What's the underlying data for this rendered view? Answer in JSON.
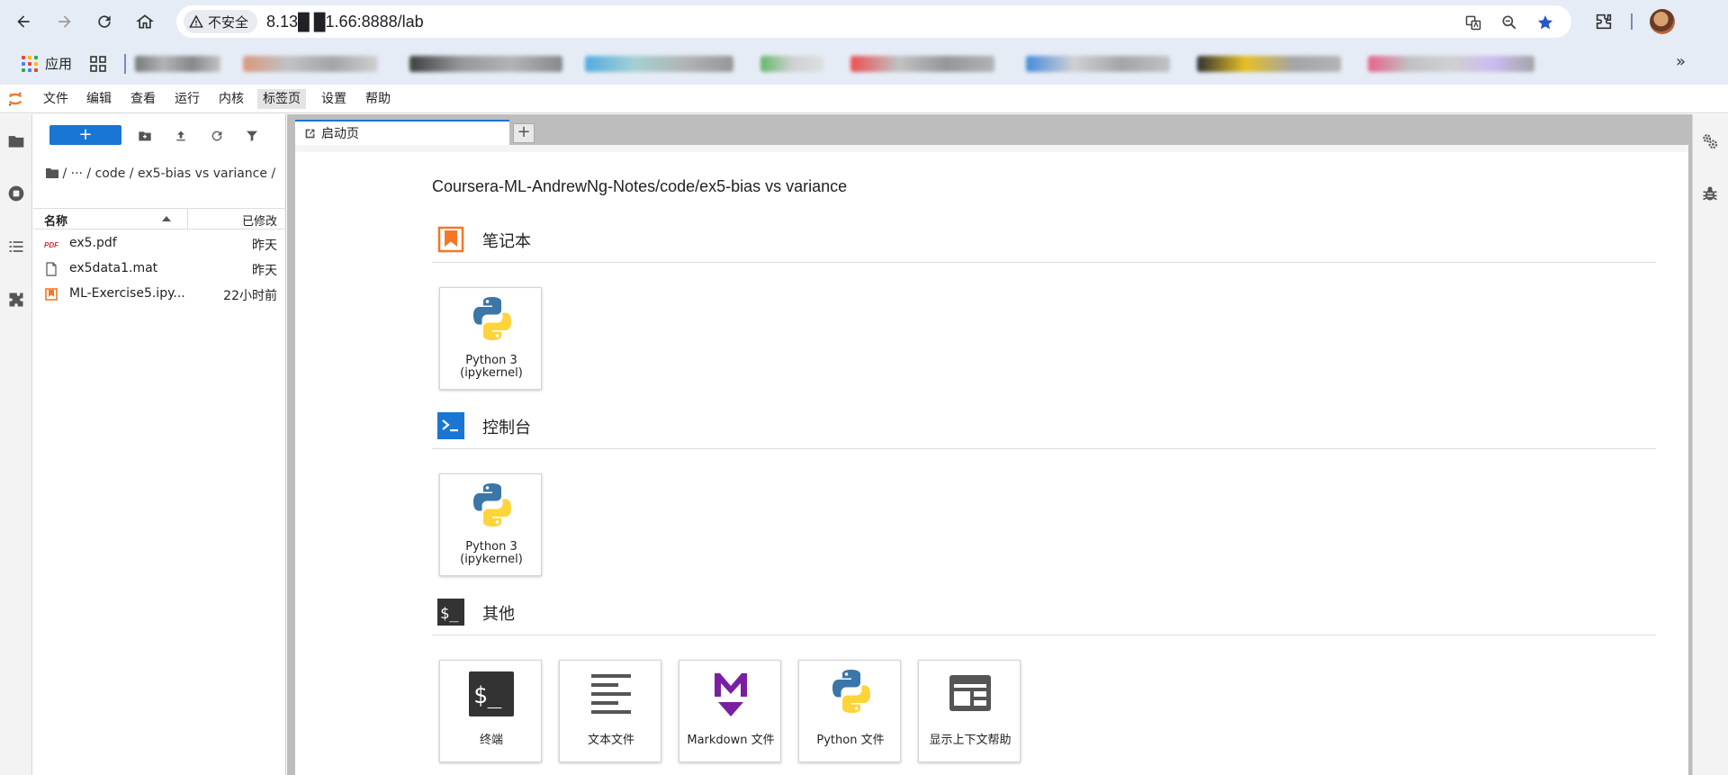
{
  "browser": {
    "security_label": "不安全",
    "url": "8.13█ █1.66:8888/lab",
    "bookmarks": {
      "apps_label": "应用"
    }
  },
  "menu": {
    "items": [
      "文件",
      "编辑",
      "查看",
      "运行",
      "内核",
      "标签页",
      "设置",
      "帮助"
    ],
    "active": "标签页"
  },
  "filebrowser": {
    "new_label": "+",
    "breadcrumb": "/   ···   / code / ex5-bias vs variance /",
    "columns": {
      "name": "名称",
      "modified": "已修改"
    },
    "files": [
      {
        "name": "ex5.pdf",
        "modified": "昨天",
        "icon": "pdf-icon"
      },
      {
        "name": "ex5data1.mat",
        "modified": "昨天",
        "icon": "file-icon"
      },
      {
        "name": "ML-Exercise5.ipy...",
        "modified": "22小时前",
        "icon": "notebook-icon"
      }
    ]
  },
  "tabs": [
    {
      "label": "启动页"
    }
  ],
  "launcher": {
    "path": "Coursera-ML-AndrewNg-Notes/code/ex5-bias vs variance",
    "sections": {
      "notebook": {
        "title": "笔记本",
        "cards": [
          {
            "label_1": "Python 3",
            "label_2": "(ipykernel)"
          }
        ]
      },
      "console": {
        "title": "控制台",
        "cards": [
          {
            "label_1": "Python 3",
            "label_2": "(ipykernel)"
          }
        ]
      },
      "other": {
        "title": "其他",
        "cards": [
          {
            "label": "终端",
            "icon": "terminal-icon"
          },
          {
            "label": "文本文件",
            "icon": "text-file-icon"
          },
          {
            "label": "Markdown 文件",
            "icon": "markdown-icon"
          },
          {
            "label": "Python 文件",
            "icon": "python-icon"
          },
          {
            "label": "显示上下文帮助",
            "icon": "context-help-icon"
          }
        ]
      }
    }
  },
  "colors": {
    "accent": "#1976d2",
    "notebook_orange": "#f37726",
    "console_blue": "#1976d2",
    "markdown_purple": "#7b1fa2",
    "python_blue": "#3a76a8",
    "python_yellow": "#ffd43b"
  }
}
